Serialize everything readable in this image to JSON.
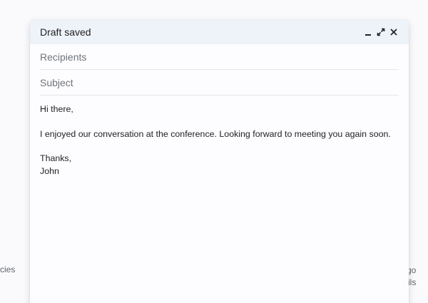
{
  "background": {
    "left_text": "cies",
    "right_text_1": "go",
    "right_text_2": "ils"
  },
  "compose": {
    "title": "Draft saved",
    "actions": {
      "minimize": "minimize-icon",
      "expand": "expand-icon",
      "close": "close-icon"
    },
    "recipients_placeholder": "Recipients",
    "subject_placeholder": "Subject",
    "body": {
      "greeting": "Hi there,",
      "paragraph": "I enjoyed our conversation at the conference. Looking forward to meeting you again soon.",
      "closing": "Thanks,",
      "signature": "John"
    }
  }
}
